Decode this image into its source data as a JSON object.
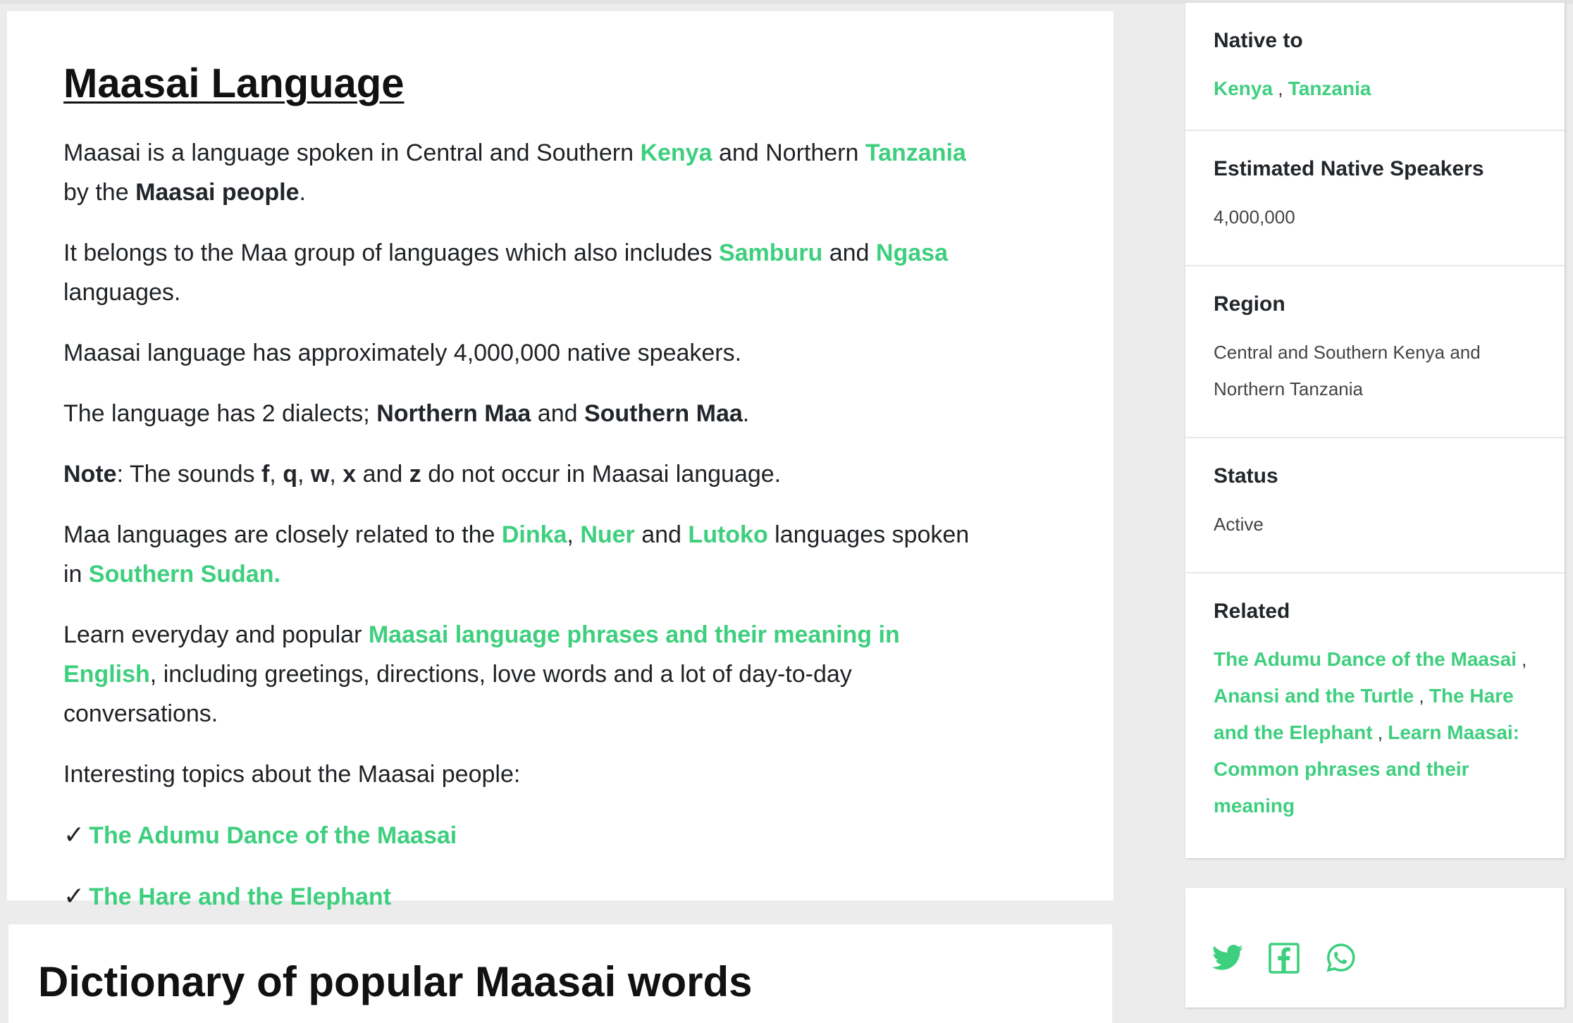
{
  "article": {
    "title": "Maasai Language",
    "p1": {
      "t1": "Maasai is a language spoken in Central and Southern ",
      "l1": "Kenya",
      "t2": " and Northern ",
      "l2": "Tanzania",
      "t3": " by the ",
      "b1": "Maasai people",
      "t4": "."
    },
    "p2": {
      "t1": "It belongs to the Maa group of languages which also includes ",
      "l1": "Samburu",
      "t2": " and ",
      "l2": "Ngasa",
      "t3": " languages."
    },
    "p3": "Maasai language has approximately 4,000,000 native speakers.",
    "p4": {
      "t1": "The language has 2 dialects; ",
      "b1": "Northern Maa",
      "t2": " and ",
      "b2": "Southern Maa",
      "t3": "."
    },
    "p5": {
      "b1": "Note",
      "t1": ": The sounds ",
      "b2": "f",
      "c1": ", ",
      "b3": "q",
      "c2": ", ",
      "b4": "w",
      "c3": ", ",
      "b5": "x",
      "t2": " and ",
      "b6": "z",
      "t3": " do not occur in Maasai language."
    },
    "p6": {
      "t1": "Maa languages are closely related to the ",
      "l1": "Dinka",
      "c1": ", ",
      "l2": "Nuer",
      "t2": " and ",
      "l3": "Lutoko",
      "t3": " languages spoken in ",
      "l4": "Southern Sudan."
    },
    "p7": {
      "t1": "Learn everyday and popular ",
      "l1": "Maasai language phrases and their meaning in English",
      "t2": ", including greetings, directions, love words and a lot of day-to-day conversations."
    },
    "p8": "Interesting topics about the Maasai people:",
    "checkmark": "✓",
    "topics": [
      "The Adumu Dance of the Maasai",
      "The Hare and the Elephant"
    ]
  },
  "dictionary": {
    "heading": "Dictionary of popular Maasai words"
  },
  "sidebar": {
    "native_to": {
      "label": "Native to",
      "links": [
        "Kenya",
        "Tanzania"
      ],
      "sep": " , "
    },
    "speakers": {
      "label": "Estimated Native Speakers",
      "value": "4,000,000"
    },
    "region": {
      "label": "Region",
      "value": "Central and Southern Kenya and Northern Tanzania"
    },
    "status": {
      "label": "Status",
      "value": "Active"
    },
    "related": {
      "label": "Related",
      "links": [
        "The Adumu Dance of the Maasai",
        "Anansi and the Turtle",
        "The Hare and the Elephant",
        "Learn Maasai: Common phrases and their meaning"
      ],
      "sep": " , "
    }
  },
  "share": {
    "icons": [
      "twitter-icon",
      "facebook-icon",
      "whatsapp-icon"
    ]
  },
  "colors": {
    "accent": "#3ecf7e",
    "page_bg": "#ececec",
    "card_bg": "#ffffff"
  }
}
